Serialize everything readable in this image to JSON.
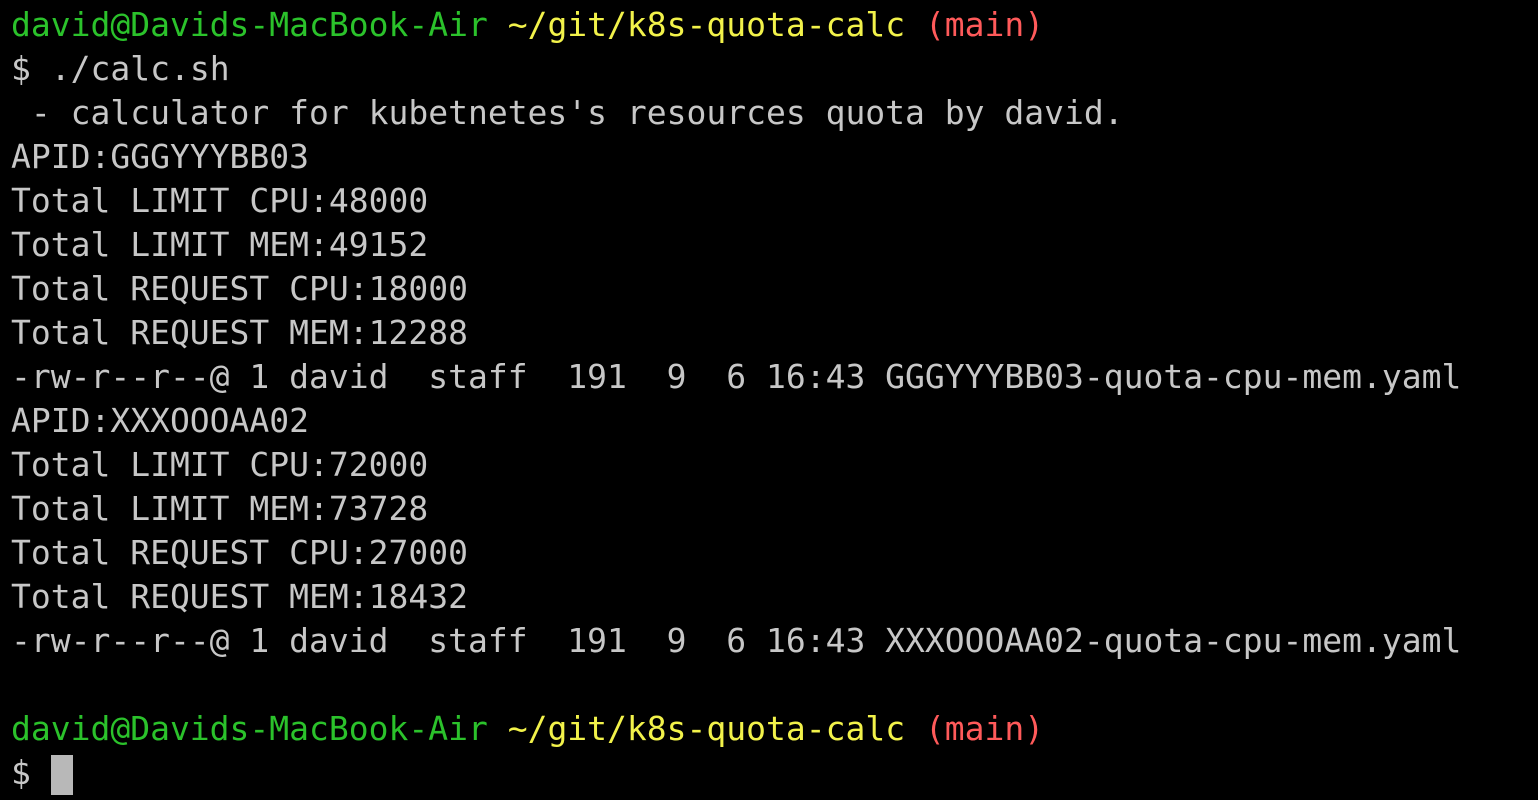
{
  "colors": {
    "background": "#000000",
    "text": "#c7c7c7",
    "prompt_user": "#2bc22b",
    "prompt_path": "#f2f24a",
    "prompt_branch": "#ff5a5a",
    "cursor": "#b8b8b8"
  },
  "prompt": {
    "user_host": "david@Davids-MacBook-Air",
    "path": "~/git/k8s-quota-calc",
    "branch": "(main)",
    "symbol": "$"
  },
  "command": "./calc.sh",
  "output": [
    " - calculator for kubetnetes's resources quota by david.",
    "APID:GGGYYYBB03",
    "Total LIMIT CPU:48000",
    "Total LIMIT MEM:49152",
    "Total REQUEST CPU:18000",
    "Total REQUEST MEM:12288",
    "-rw-r--r--@ 1 david  staff  191  9  6 16:43 GGGYYYBB03-quota-cpu-mem.yaml",
    "APID:XXXOOOAA02",
    "Total LIMIT CPU:72000",
    "Total LIMIT MEM:73728",
    "Total REQUEST CPU:27000",
    "Total REQUEST MEM:18432",
    "-rw-r--r--@ 1 david  staff  191  9  6 16:43 XXXOOOAA02-quota-cpu-mem.yaml",
    ""
  ]
}
